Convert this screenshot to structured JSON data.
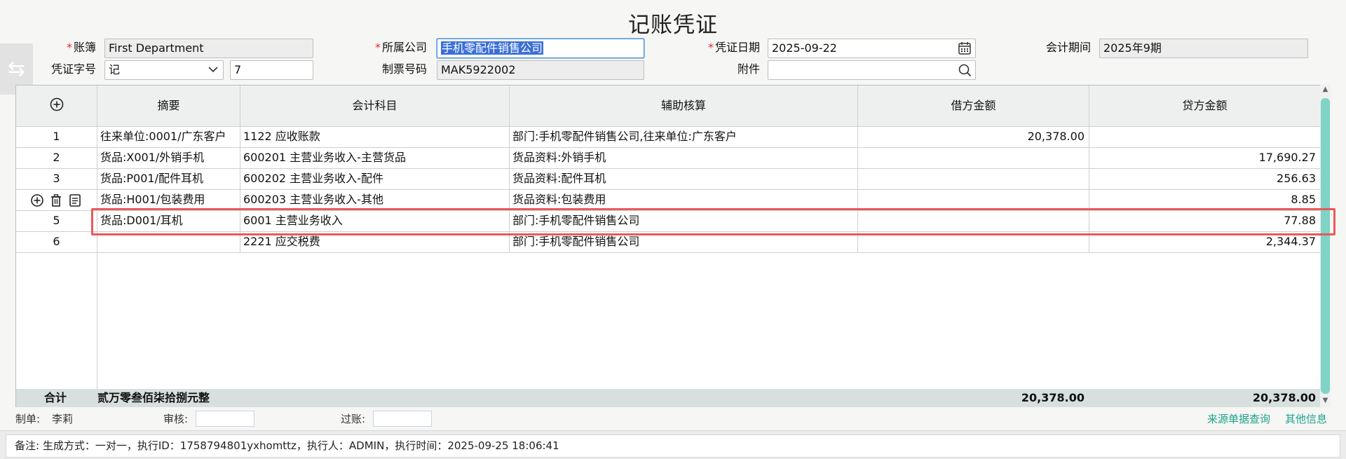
{
  "title": "记账凭证",
  "side_tab_glyph": "⇆",
  "header": {
    "ledger": {
      "label": "账簿",
      "value": "First Department"
    },
    "company": {
      "label": "所属公司",
      "value": "手机零配件销售公司"
    },
    "date": {
      "label": "凭证日期",
      "value": "2025-09-22"
    },
    "period": {
      "label": "会计期间",
      "value": "2025年9期"
    },
    "voucher_type": {
      "label": "凭证字号",
      "value": "记",
      "number": "7"
    },
    "invoice_no": {
      "label": "制票号码",
      "value": "MAK5922002"
    },
    "attachment": {
      "label": "附件",
      "value": ""
    }
  },
  "table": {
    "columns": [
      "摘要",
      "会计科目",
      "辅助核算",
      "借方金额",
      "贷方金额"
    ],
    "rows": [
      {
        "idx": "1",
        "summary": "往来单位:0001/广东客户",
        "account": "1122 应收账款",
        "aux": "部门:手机零配件销售公司,往来单位:广东客户",
        "debit": "20,378.00",
        "credit": ""
      },
      {
        "idx": "2",
        "summary": "货品:X001/外销手机",
        "account": "600201 主营业务收入-主营货品",
        "aux": "货品资料:外销手机",
        "debit": "",
        "credit": "17,690.27"
      },
      {
        "idx": "3",
        "summary": "货品:P001/配件耳机",
        "account": "600202 主营业务收入-配件",
        "aux": "货品资料:配件耳机",
        "debit": "",
        "credit": "256.63"
      },
      {
        "idx": "4",
        "summary": "货品:H001/包装费用",
        "account": "600203 主营业务收入-其他",
        "aux": "货品资料:包装费用",
        "debit": "",
        "credit": "8.85"
      },
      {
        "idx": "5",
        "summary": "货品:D001/耳机",
        "account": "6001 主营业务收入",
        "aux": "部门:手机零配件销售公司",
        "debit": "",
        "credit": "77.88"
      },
      {
        "idx": "6",
        "summary": "",
        "account": "2221 应交税费",
        "aux": "部门:手机零配件销售公司",
        "debit": "",
        "credit": "2,344.37"
      }
    ],
    "total": {
      "label": "合计",
      "words": "贰万零叁佰柒拾捌元整",
      "debit": "20,378.00",
      "credit": "20,378.00"
    }
  },
  "footer": {
    "maker_label": "制单:",
    "maker": "李莉",
    "review_label": "审核:",
    "post_label": "过账:",
    "link_source": "来源单据查询",
    "link_other": "其他信息"
  },
  "memo": "备注: 生成方式：一对一，执行ID：1758794801yxhomttz，执行人：ADMIN，执行时间：2025-09-25 18:06:41",
  "colors": {
    "highlight": "#e85a5a",
    "link": "#19a38d",
    "scroll": "#7fd3c7"
  }
}
